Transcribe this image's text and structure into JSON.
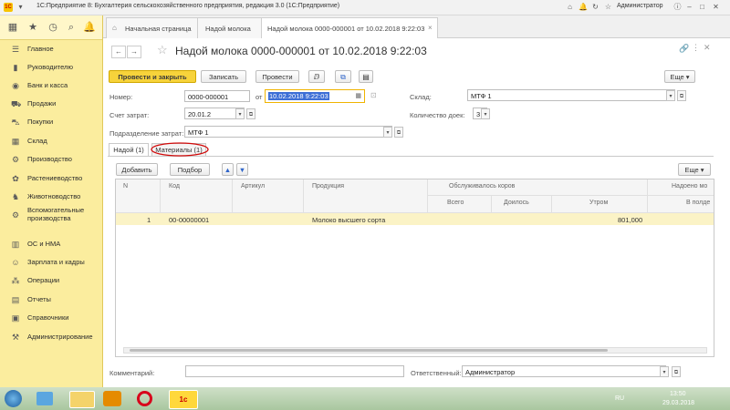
{
  "window": {
    "title": "1С:Предприятие 8: Бухгалтерия сельскохозяйственного предприятия, редакция 3.0  (1С:Предприятие)",
    "user": "Администратор"
  },
  "sidebar": {
    "items": [
      {
        "label": "Главное",
        "icon": "menu-icon"
      },
      {
        "label": "Руководителю",
        "icon": "chart-icon"
      },
      {
        "label": "Банк и касса",
        "icon": "bank-icon"
      },
      {
        "label": "Продажи",
        "icon": "cart-icon"
      },
      {
        "label": "Покупки",
        "icon": "basket-icon"
      },
      {
        "label": "Склад",
        "icon": "warehouse-icon"
      },
      {
        "label": "Производство",
        "icon": "factory-icon"
      },
      {
        "label": "Растениеводство",
        "icon": "plant-icon"
      },
      {
        "label": "Животноводство",
        "icon": "animal-icon"
      },
      {
        "label": "Вспомогательные производства",
        "icon": "gear-icon"
      },
      {
        "label": "ОС и НМА",
        "icon": "building-icon"
      },
      {
        "label": "Зарплата и кадры",
        "icon": "people-icon"
      },
      {
        "label": "Операции",
        "icon": "operations-icon"
      },
      {
        "label": "Отчеты",
        "icon": "report-icon"
      },
      {
        "label": "Справочники",
        "icon": "book-icon"
      },
      {
        "label": "Администрирование",
        "icon": "settings-icon"
      }
    ]
  },
  "tabs": [
    {
      "label": "Начальная страница"
    },
    {
      "label": "Надой молока"
    },
    {
      "label": "Надой молока 0000-000001 от 10.02.2018 9:22:03",
      "close": "×"
    }
  ],
  "form": {
    "title": "Надой молока 0000-000001 от 10.02.2018 9:22:03",
    "toolbar": {
      "post_close": "Провести и закрыть",
      "save": "Записать",
      "post": "Провести",
      "more": "Еще"
    },
    "number_label": "Номер:",
    "number": "0000-000001",
    "date_from_label": "от",
    "date": "10.02.2018  9:22:03",
    "warehouse_label": "Склад:",
    "warehouse": "МТФ 1",
    "account_label": "Счет затрат:",
    "account": "20.01.2",
    "milkings_label": "Количество доек:",
    "milkings": "3",
    "division_label": "Подразделение затрат:",
    "division": "МТФ 1",
    "inner_tabs": [
      "Надой (1)",
      "Материалы (1)"
    ],
    "table_toolbar": {
      "add": "Добавить",
      "select": "Подбор",
      "more": "Еще"
    },
    "columns": {
      "n": "N",
      "code": "Код",
      "article": "Артикул",
      "product": "Продукция",
      "cows_group": "Обслуживалось коров",
      "total": "Всего",
      "dry": "Доилось",
      "morning": "Утром",
      "milked_group": "Надоено мо",
      "noon": "В полде"
    },
    "rows": [
      {
        "n": "1",
        "code": "00-00000001",
        "article": "",
        "product": "Молоко высшего сорта",
        "total": "",
        "dry": "",
        "morning": "801,000",
        "noon": ""
      }
    ],
    "comment_label": "Комментарий:",
    "comment": "",
    "responsible_label": "Ответственный:",
    "responsible": "Администратор"
  },
  "taskbar": {
    "lang": "RU",
    "time": "13:50",
    "date": "29.03.2018"
  },
  "colors": {
    "sidebar": "#fbed9e",
    "primary": "#f7d33b",
    "selected_row": "#fbf3c6",
    "date_highlight": "#3d6fd6"
  }
}
